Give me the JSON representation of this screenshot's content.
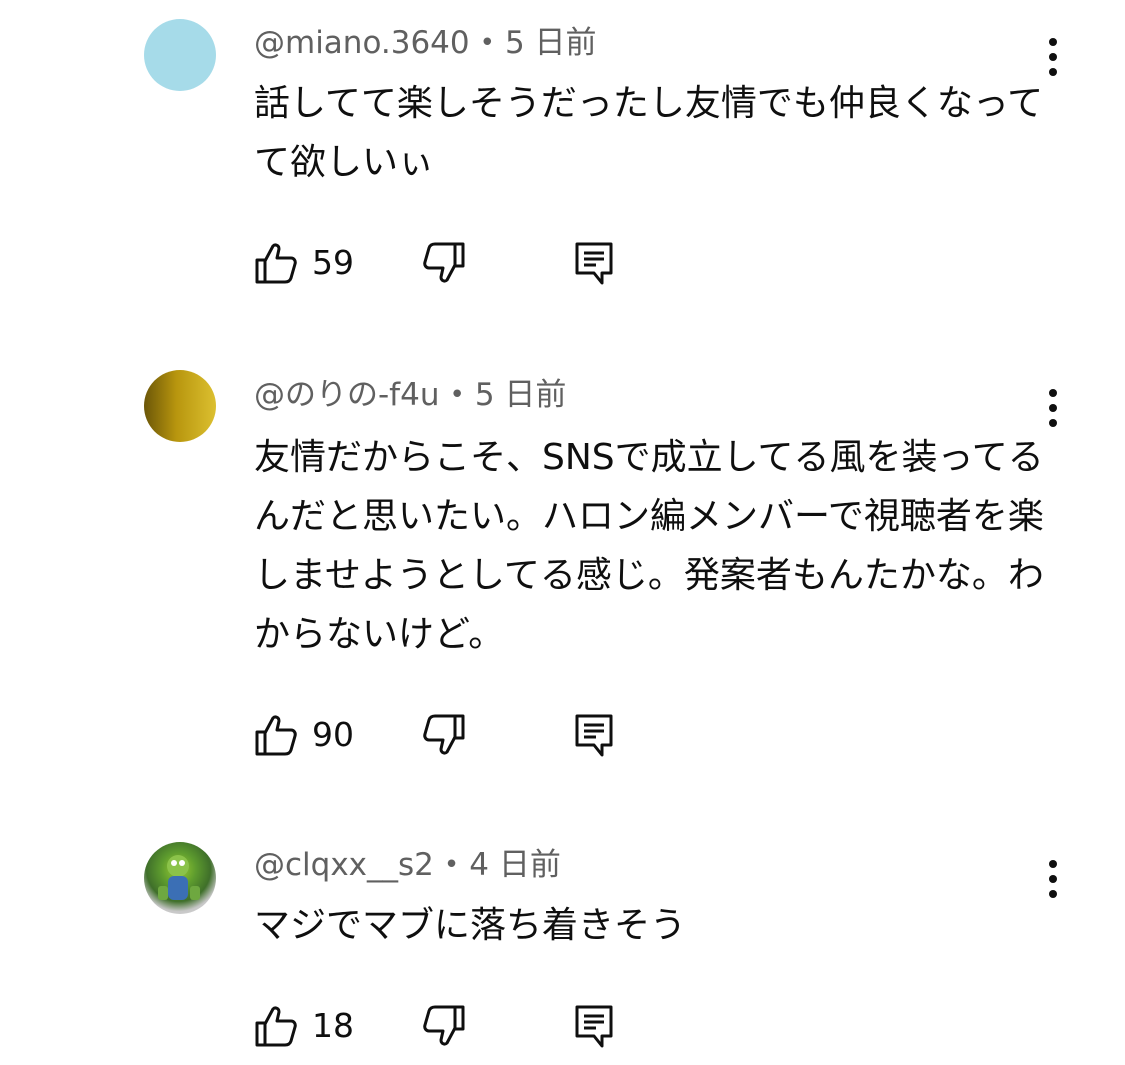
{
  "comments": [
    {
      "author": "@miano.3640",
      "separator": "•",
      "time": "5 日前",
      "text": "話してて楽しそうだったし友情でも仲良くなってて欲しいぃ",
      "likes": "59",
      "avatar_color": "#a6dbe9"
    },
    {
      "author": "@のりの-f4u",
      "separator": "•",
      "time": "5 日前",
      "text": "友情だからこそ、SNSで成立してる風を装ってるんだと思いたい。ハロン編メンバーで視聴者を楽しませようとしてる感じ。発案者もんたかな。わからないけど。",
      "likes": "90",
      "avatar_color": "#b8960e"
    },
    {
      "author": "@clqxx__s2",
      "separator": "•",
      "time": "4 日前",
      "text": "マジでマブに落ち着きそう",
      "likes": "18",
      "avatar_color": "#4f8a36"
    }
  ],
  "icons": {
    "like": "thumbs-up-icon",
    "dislike": "thumbs-down-icon",
    "reply": "reply-icon",
    "menu": "more-vert-icon"
  }
}
